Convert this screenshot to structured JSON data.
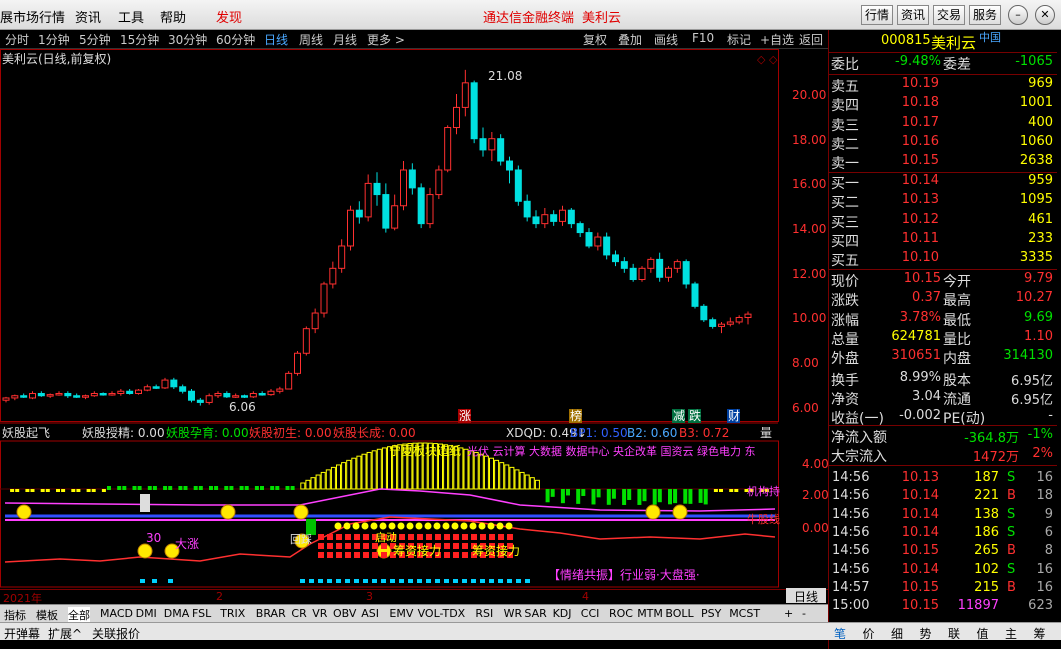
{
  "menu": {
    "items": [
      "展市场行情",
      "资讯",
      "工具",
      "帮助"
    ],
    "discover": "发现",
    "center_title": "通达信金融终端",
    "stock_title": "美利云",
    "right_buttons": [
      "行情",
      "资讯",
      "交易",
      "服务"
    ]
  },
  "periods": {
    "items": [
      "分时",
      "1分钟",
      "5分钟",
      "15分钟",
      "30分钟",
      "60分钟",
      "日线",
      "周线",
      "月线",
      "更多 >"
    ],
    "active": "日线",
    "tools": [
      "复权",
      "叠加",
      "画线",
      "F10",
      "标记",
      "+自选",
      "返回"
    ]
  },
  "chart": {
    "label": "美利云(日线,前复权)",
    "high_label": "21.08",
    "low_label": "6.06",
    "y_ticks": [
      "20.00",
      "18.00",
      "16.00",
      "14.00",
      "12.00",
      "10.00",
      "8.00",
      "6.00"
    ],
    "markers": [
      "涨",
      "榜",
      "减",
      "跌",
      "财"
    ],
    "indicator_header": [
      {
        "t": "妖股起飞",
        "c": "#ddd"
      },
      {
        "t": "妖股授精: 0.00",
        "c": "#ddd"
      },
      {
        "t": "妖股孕育: 0.00",
        "c": "#00e000"
      },
      {
        "t": "妖股初生: 0.00",
        "c": "#ff3030"
      },
      {
        "t": "妖股长成: 0.00",
        "c": "#ff3030"
      },
      {
        "t": "XDQD: 0.49↓",
        "c": "#ddd"
      },
      {
        "t": "BP1: 0.50",
        "c": "#3060ff"
      },
      {
        "t": "B2: 0.60",
        "c": "#4aa8ff"
      },
      {
        "t": "B3: 0.72",
        "c": "#ff3030"
      },
      {
        "t": "量",
        "c": "#ddd"
      }
    ],
    "lower_y": [
      "4.00",
      "2.00",
      "0.00"
    ],
    "lower_texts": {
      "yz": "宁夏板块造纸",
      "concepts": "光伏 云计算 大数据 数据中心 央企改革 国资云 绿色电力 东",
      "jg": "机构持",
      "nrg": "牛股线",
      "dz": "大涨",
      "ss": "启动",
      "jl": "筹资接力",
      "jl2": "筹资接力",
      "zs": "回踩",
      "qx": "【情绪共振】行业弱·大盘强·",
      "n30": "30"
    },
    "x_labels": [
      "2021年",
      "2",
      "3",
      "4"
    ],
    "rijian": "日线"
  },
  "right": {
    "code": "000815",
    "name": "美利云",
    "flag": "中国",
    "wb": {
      "l1": "委比",
      "v1": "-9.48%",
      "l2": "委差",
      "v2": "-1065"
    },
    "sells": [
      {
        "l": "卖五",
        "p": "10.19",
        "v": "969"
      },
      {
        "l": "卖四",
        "p": "10.18",
        "v": "1001"
      },
      {
        "l": "卖三",
        "p": "10.17",
        "v": "400"
      },
      {
        "l": "卖二",
        "p": "10.16",
        "v": "1060"
      },
      {
        "l": "卖一",
        "p": "10.15",
        "v": "2638"
      }
    ],
    "buys": [
      {
        "l": "买一",
        "p": "10.14",
        "v": "959"
      },
      {
        "l": "买二",
        "p": "10.13",
        "v": "1095"
      },
      {
        "l": "买三",
        "p": "10.12",
        "v": "461"
      },
      {
        "l": "买四",
        "p": "10.11",
        "v": "233"
      },
      {
        "l": "买五",
        "p": "10.10",
        "v": "3335"
      }
    ],
    "fields": [
      {
        "a": "现价",
        "b": "10.15",
        "bc": "red",
        "c": "今开",
        "d": "9.79",
        "dc": "red"
      },
      {
        "a": "涨跌",
        "b": "0.37",
        "bc": "red",
        "c": "最高",
        "d": "10.27",
        "dc": "red"
      },
      {
        "a": "涨幅",
        "b": "3.78%",
        "bc": "red",
        "c": "最低",
        "d": "9.69",
        "dc": "grn"
      },
      {
        "a": "总量",
        "b": "624781",
        "bc": "yel",
        "c": "量比",
        "d": "1.10",
        "dc": "red"
      },
      {
        "a": "外盘",
        "b": "310651",
        "bc": "red",
        "c": "内盘",
        "d": "314130",
        "dc": "grn"
      },
      {
        "a": "换手",
        "b": "8.99%",
        "bc": "wht",
        "c": "股本",
        "d": "6.95亿",
        "dc": "wht"
      },
      {
        "a": "净资",
        "b": "3.04",
        "bc": "wht",
        "c": "流通",
        "d": "6.95亿",
        "dc": "wht"
      },
      {
        "a": "收益(一)",
        "b": "-0.002",
        "bc": "wht",
        "c": "PE(动)",
        "d": "-",
        "dc": "wht"
      }
    ],
    "flow": [
      {
        "a": "净流入额",
        "b": "-364.8万",
        "c": "-1%",
        "cc": "grn"
      },
      {
        "a": "大宗流入",
        "b": "1472万",
        "c": "2%",
        "cc": "red"
      }
    ],
    "ticks": [
      {
        "t": "14:56",
        "p": "10.13",
        "v": "187",
        "s": "S",
        "n": "16"
      },
      {
        "t": "14:56",
        "p": "10.14",
        "v": "221",
        "s": "B",
        "n": "18"
      },
      {
        "t": "14:56",
        "p": "10.14",
        "v": "138",
        "s": "S",
        "n": "9"
      },
      {
        "t": "14:56",
        "p": "10.14",
        "v": "186",
        "s": "S",
        "n": "6"
      },
      {
        "t": "14:56",
        "p": "10.15",
        "v": "265",
        "s": "B",
        "n": "8"
      },
      {
        "t": "14:56",
        "p": "10.14",
        "v": "102",
        "s": "S",
        "n": "16"
      },
      {
        "t": "14:57",
        "p": "10.15",
        "v": "215",
        "s": "B",
        "n": "16"
      },
      {
        "t": "15:00",
        "p": "10.15",
        "v": "11897",
        "s": "",
        "n": "623"
      }
    ],
    "tabs": [
      "笔",
      "价",
      "细",
      "势",
      "联",
      "值",
      "主",
      "筹"
    ]
  },
  "indicator_tabs": [
    "指标",
    "模板",
    "全部",
    "MACD",
    "DMI",
    "DMA",
    "FSL",
    "TRIX",
    "BRAR",
    "CR",
    "VR",
    "OBV",
    "ASI",
    "EMV",
    "VOL-TDX",
    "RSI",
    "WR",
    "SAR",
    "KDJ",
    "CCI",
    "ROC",
    "MTM",
    "BOLL",
    "PSY",
    "MCST"
  ],
  "bottom_tabs": [
    "开弹幕",
    "扩展^",
    "关联报价"
  ],
  "colors": {
    "up": "#ff3030",
    "down": "#00e0e0",
    "bg": "#000000",
    "accent": "#e00000"
  }
}
